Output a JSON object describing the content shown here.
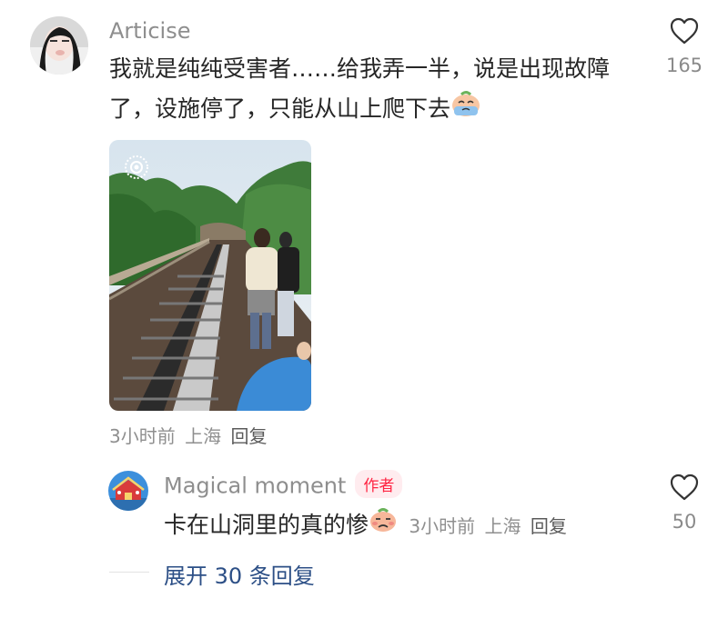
{
  "comment": {
    "username": "Articise",
    "text": "我就是纯纯受害者……给我弄一半，说是出现故障了，设施停了，只能从山上爬下去",
    "emoji": "crying-face-emoji",
    "like_icon": "heart-outline-icon",
    "like_count": "165",
    "time": "3小时前",
    "location": "上海",
    "reply_label": "回复"
  },
  "reply": {
    "username": "Magical moment",
    "badge": "作者",
    "text": "卡在山洞里的真的惨",
    "emoji": "sad-face-emoji",
    "time": "3小时前",
    "location": "上海",
    "reply_label": "回复",
    "like_icon": "heart-outline-icon",
    "like_count": "50"
  },
  "expand": {
    "label": "展开 30 条回复"
  },
  "colors": {
    "username": "#8e8e8e",
    "text": "#262626",
    "meta": "#8f8f8f",
    "author_badge": "#ff2442",
    "author_badge_bg": "#ffecef",
    "expand_link": "#2c4f86"
  }
}
